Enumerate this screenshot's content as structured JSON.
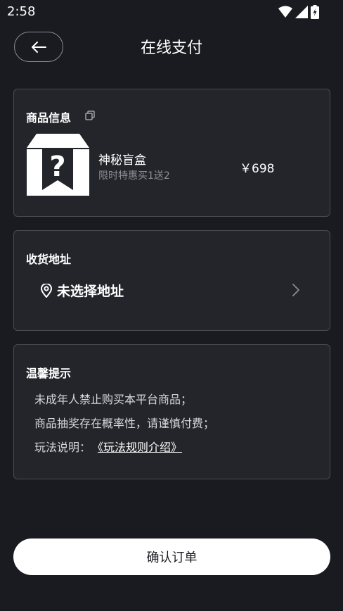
{
  "status_bar": {
    "time": "2:58",
    "icons": [
      "wifi-icon",
      "signal-icon",
      "battery-charging-icon"
    ]
  },
  "header": {
    "title": "在线支付",
    "back_icon": "arrow-left-icon"
  },
  "product_card": {
    "title": "商品信息",
    "copy_icon": "copy-icon",
    "image_icon": "mystery-box-icon",
    "name": "神秘盲盒",
    "subtitle": "限时特惠买1送2",
    "price": "￥698"
  },
  "address_card": {
    "title": "收货地址",
    "location_icon": "location-pin-icon",
    "address_text": "未选择地址",
    "chevron_icon": "chevron-right-icon"
  },
  "tips_card": {
    "title": "温馨提示",
    "line1": "未成年人禁止购买本平台商品；",
    "line2": "商品抽奖存在概率性，请谨慎付费；",
    "rules_label": "玩法说明：",
    "rules_link": "《玩法规则介绍》"
  },
  "footer": {
    "confirm_label": "确认订单"
  },
  "colors": {
    "background": "#1a1b20",
    "card": "#24252b",
    "card_border": "#4a4b52",
    "button_bg": "#ffffff"
  }
}
